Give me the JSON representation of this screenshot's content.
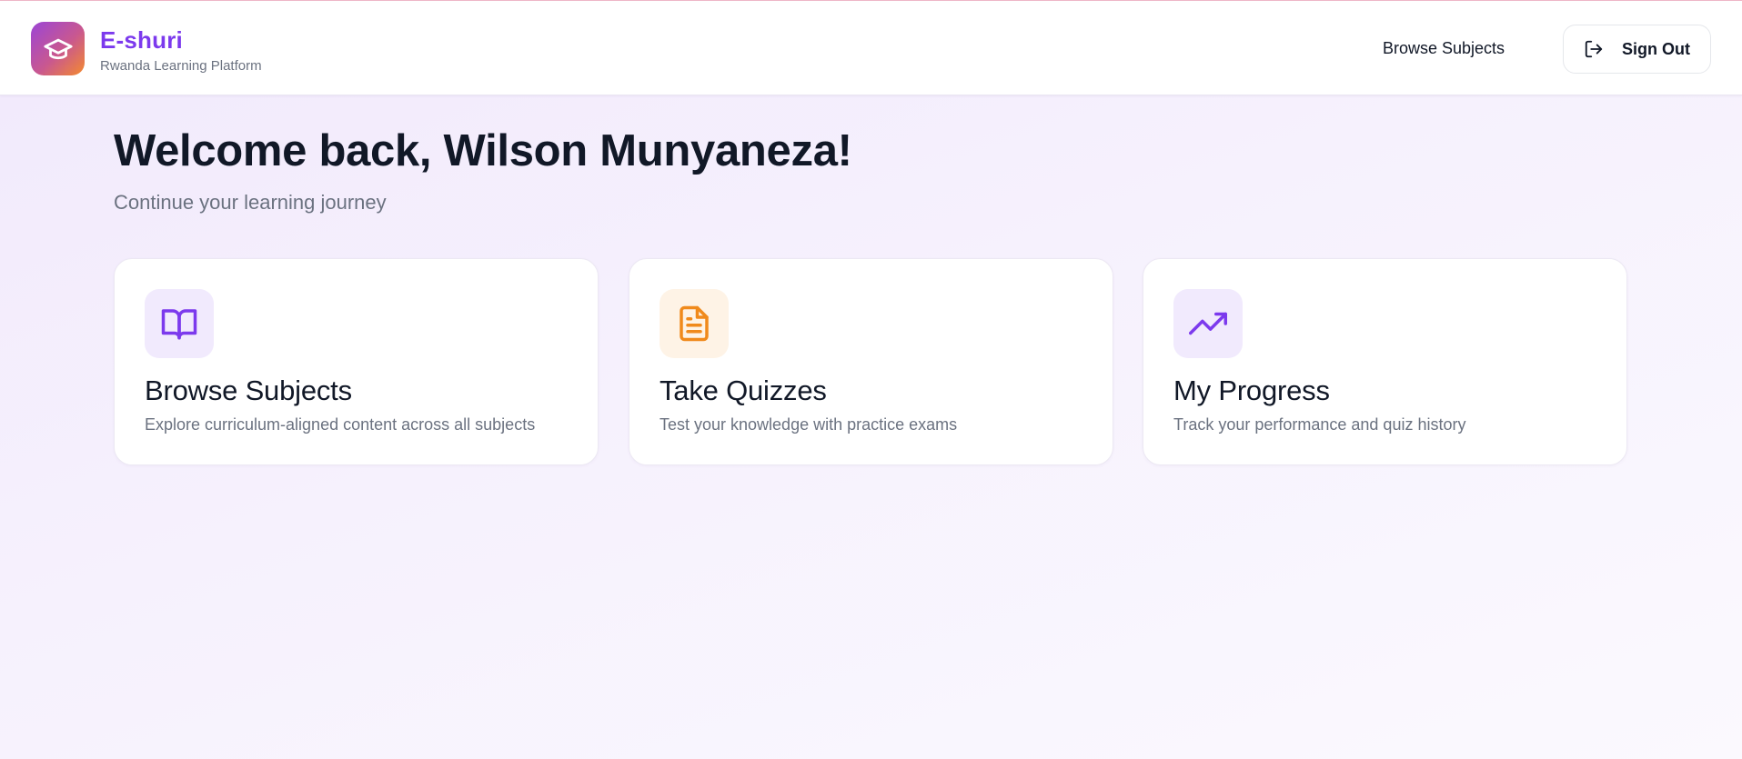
{
  "app": {
    "name": "E-shuri",
    "tagline": "Rwanda Learning Platform",
    "logo_icon": "graduation-cap-icon"
  },
  "nav": {
    "browse_label": "Browse Subjects",
    "signout_label": "Sign Out",
    "signout_icon": "log-out-icon"
  },
  "main": {
    "welcome": "Welcome back, Wilson Munyaneza!",
    "subtitle": "Continue your learning journey",
    "cards": [
      {
        "title": "Browse Subjects",
        "description": "Explore curriculum-aligned content across all subjects",
        "icon": "book-open-icon",
        "icon_color": "#7c3aed",
        "icon_bg": "#f1eafd"
      },
      {
        "title": "Take Quizzes",
        "description": "Test your knowledge with practice exams",
        "icon": "file-text-icon",
        "icon_color": "#f08a1c",
        "icon_bg": "#fef3e6"
      },
      {
        "title": "My Progress",
        "description": "Track your performance and quiz history",
        "icon": "trending-up-icon",
        "icon_color": "#7c3aed",
        "icon_bg": "#f1eafd"
      }
    ]
  },
  "colors": {
    "brand": "#7c3aed",
    "accent_orange": "#f08a1c",
    "text_primary": "#111827",
    "text_muted": "#6b7280"
  }
}
